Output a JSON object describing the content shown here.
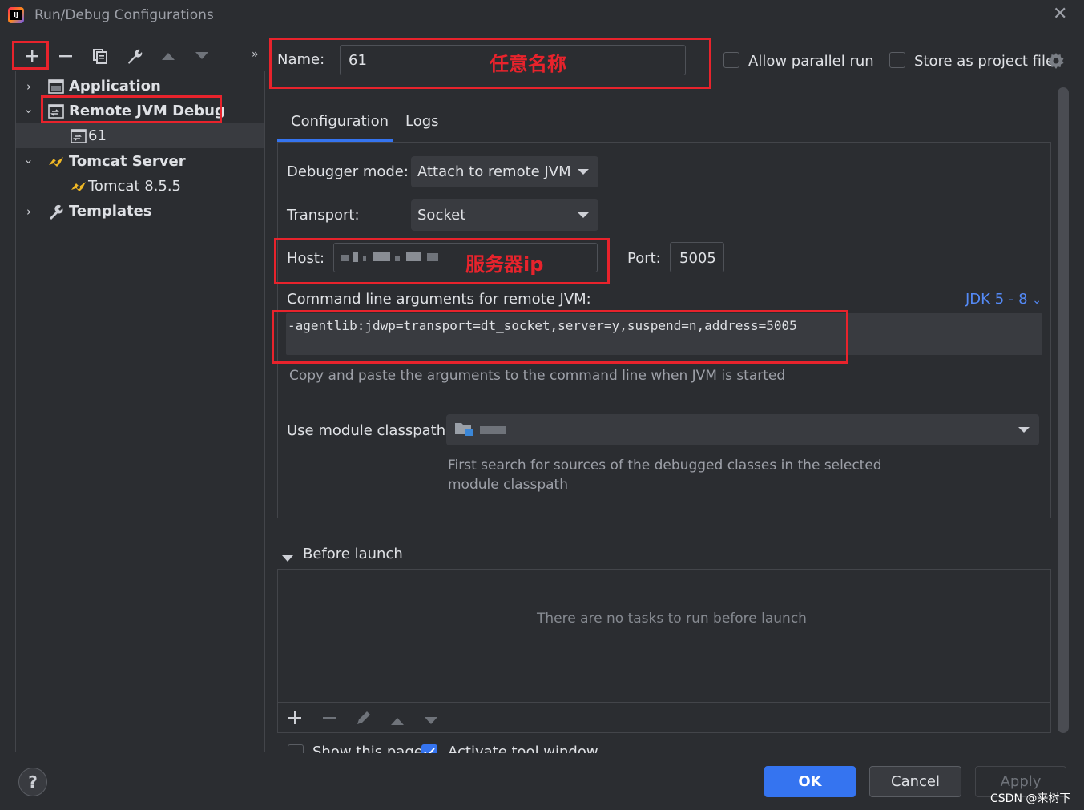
{
  "window": {
    "title": "Run/Debug Configurations",
    "close_icon": "close-icon"
  },
  "toolbar": {
    "icons": [
      "add-icon",
      "remove-icon",
      "copy-icon",
      "wrench-icon",
      "move-up-icon",
      "move-down-icon",
      "expand-more-icon"
    ]
  },
  "tree": {
    "items": [
      {
        "label": "Application",
        "icon": "application-icon",
        "expanded": false,
        "bold": true
      },
      {
        "label": "Remote JVM Debug",
        "icon": "remote-debug-icon",
        "expanded": true,
        "bold": true
      },
      {
        "label": "61",
        "icon": "remote-debug-icon",
        "selected": true
      },
      {
        "label": "Tomcat Server",
        "icon": "tomcat-icon",
        "expanded": true,
        "bold": true
      },
      {
        "label": "Tomcat 8.5.5",
        "icon": "tomcat-icon"
      },
      {
        "label": "Templates",
        "icon": "wrench-icon",
        "expanded": false,
        "bold": true
      }
    ]
  },
  "name": {
    "label": "Name:",
    "value": "61",
    "annotation": "任意名称"
  },
  "options": {
    "allow_parallel": "Allow parallel run",
    "store_as_project": "Store as project file"
  },
  "tabs": [
    {
      "label": "Configuration",
      "active": true
    },
    {
      "label": "Logs",
      "active": false
    }
  ],
  "config": {
    "debugger_mode_label": "Debugger mode:",
    "debugger_mode_value": "Attach to remote JVM",
    "transport_label": "Transport:",
    "transport_value": "Socket",
    "host_label": "Host:",
    "host_annotation": "服务器ip",
    "port_label": "Port:",
    "port_value": "5005",
    "cmdline_label": "Command line arguments for remote JVM:",
    "jdk_selector": "JDK 5 - 8",
    "cmdline_value": "-agentlib:jdwp=transport=dt_socket,server=y,suspend=n,address=5005",
    "cmdline_hint": "Copy and paste the arguments to the command line when JVM is started",
    "module_label": "Use module classpath:",
    "module_hint_line1": "First search for sources of the debugged classes in the selected",
    "module_hint_line2": "module classpath"
  },
  "before_launch": {
    "title": "Before launch",
    "empty_text": "There are no tasks to run before launch",
    "show_page": "Show this page",
    "activate_tool_window": "Activate tool window"
  },
  "buttons": {
    "ok": "OK",
    "cancel": "Cancel",
    "apply": "Apply",
    "help": "?"
  },
  "watermark": "CSDN @来树下",
  "colors": {
    "background": "#2b2d31",
    "accent": "#3574f0",
    "annotation_red": "#e8232c",
    "link": "#548af7"
  }
}
